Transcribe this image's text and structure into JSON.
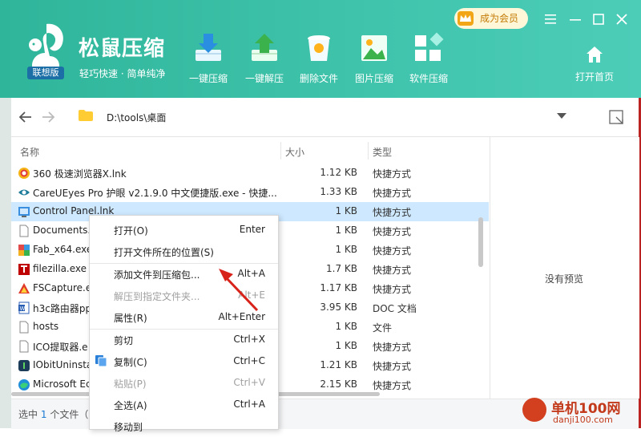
{
  "header": {
    "app_title": "松鼠压缩",
    "slogan": "轻巧快速 · 简单纯净",
    "badge": "联想版",
    "vip_label": "成为会员",
    "home_label": "打开首页",
    "tools": [
      {
        "label": "一键压缩",
        "icon": "compress-icon"
      },
      {
        "label": "一键解压",
        "icon": "extract-icon"
      },
      {
        "label": "删除文件",
        "icon": "delete-file-icon"
      },
      {
        "label": "图片压缩",
        "icon": "image-compress-icon"
      },
      {
        "label": "软件压缩",
        "icon": "software-compress-icon"
      }
    ],
    "accent": "#3cc1a8"
  },
  "address": {
    "path": "D:\\tools\\桌面"
  },
  "list": {
    "columns": {
      "name": "名称",
      "size": "大小",
      "type": "类型"
    },
    "rows": [
      {
        "name": "360 极速浏览器X.lnk",
        "size": "1.12 KB",
        "type": "快捷方式",
        "icon": "browser-360-icon"
      },
      {
        "name": "CareUEyes Pro 护眼 v2.1.9.0 中文便捷版.exe - 快捷...",
        "size": "1.33 KB",
        "type": "快捷方式",
        "icon": "eye-icon"
      },
      {
        "name": "Control Panel.lnk",
        "size": "1 KB",
        "type": "快捷方式",
        "icon": "control-panel-icon"
      },
      {
        "name": "Documents.",
        "size": "1 KB",
        "type": "快捷方式",
        "icon": "document-icon"
      },
      {
        "name": "Fab_x64.exe",
        "size": "1 KB",
        "type": "快捷方式",
        "icon": "app-icon"
      },
      {
        "name": "filezilla.exe -",
        "size": "1.7 KB",
        "type": "快捷方式",
        "icon": "filezilla-icon"
      },
      {
        "name": "FSCapture.e",
        "size": "1.17 KB",
        "type": "快捷方式",
        "icon": "fscapture-icon"
      },
      {
        "name": "h3c路由器pp",
        "size": "3.95 KB",
        "type": "DOC 文档",
        "icon": "word-doc-icon"
      },
      {
        "name": "hosts",
        "size": "1 KB",
        "type": "文件",
        "icon": "file-icon"
      },
      {
        "name": "ICO提取器.e",
        "size": "1 KB",
        "type": "快捷方式",
        "icon": "app-icon"
      },
      {
        "name": "IObitUninsta",
        "size": "1.21 KB",
        "type": "快捷方式",
        "icon": "iobit-icon"
      },
      {
        "name": "Microsoft Ec",
        "size": "2.15 KB",
        "type": "快捷方式",
        "icon": "edge-icon"
      }
    ]
  },
  "preview": {
    "empty_text": "没有预览"
  },
  "status": {
    "prefix": "选中",
    "count": "1",
    "suffix": "个文件（"
  },
  "context_menu": {
    "items": [
      {
        "label": "打开(O)",
        "shortcut": "Enter",
        "disabled": false
      },
      {
        "label": "打开文件所在的位置(S)",
        "shortcut": "",
        "disabled": false
      },
      {
        "label": "添加文件到压缩包...",
        "shortcut": "Alt+A",
        "disabled": false
      },
      {
        "label": "解压到指定文件夹...",
        "shortcut": "Alt+E",
        "disabled": true
      },
      {
        "label": "属性(R)",
        "shortcut": "Alt+Enter",
        "disabled": false
      },
      {
        "label": "剪切",
        "shortcut": "Ctrl+X",
        "disabled": false
      },
      {
        "label": "复制(C)",
        "shortcut": "Ctrl+C",
        "disabled": false
      },
      {
        "label": "粘贴(P)",
        "shortcut": "Ctrl+V",
        "disabled": true
      },
      {
        "label": "全选(A)",
        "shortcut": "Ctrl+A",
        "disabled": false
      },
      {
        "label": "移动到",
        "shortcut": "",
        "disabled": false
      }
    ]
  },
  "watermark": {
    "title": "单机100网",
    "url": "danji100.com"
  }
}
